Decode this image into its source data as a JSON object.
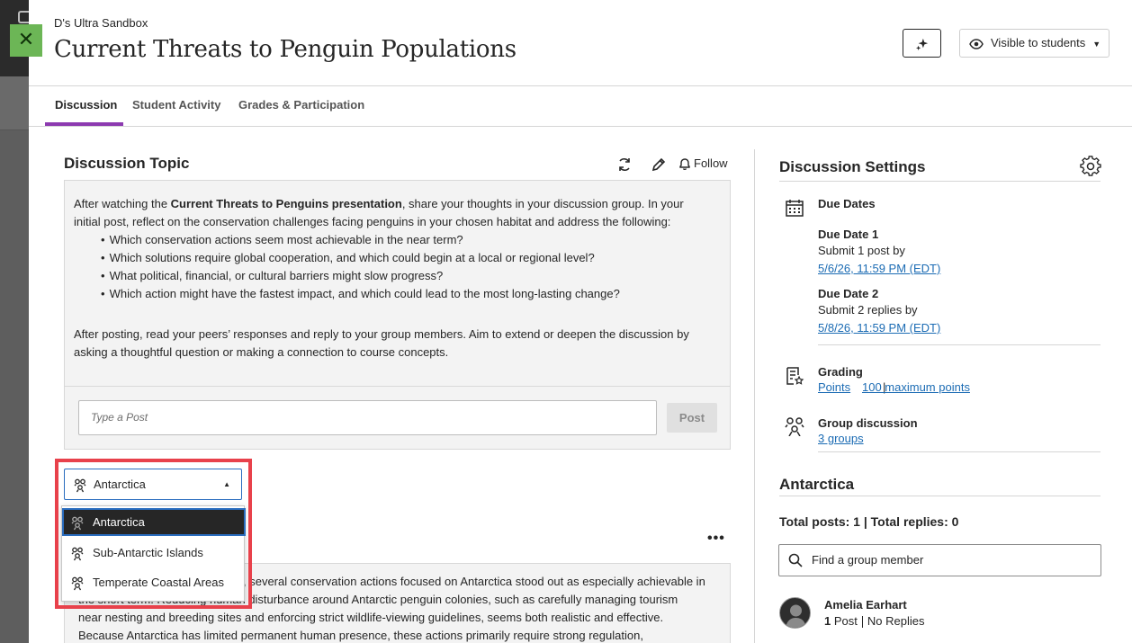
{
  "header": {
    "course_name": "D's Ultra Sandbox",
    "title": "Current Threats to Penguin Populations",
    "visibility_label": "Visible to students",
    "close_icon": "close-icon",
    "ai_icon": "sparkle-icon"
  },
  "tabs": [
    {
      "label": "Discussion",
      "active": true
    },
    {
      "label": "Student Activity",
      "active": false
    },
    {
      "label": "Grades & Participation",
      "active": false
    }
  ],
  "topic": {
    "heading": "Discussion Topic",
    "follow_label": "Follow",
    "intro_pre": "After watching the ",
    "intro_bold": "Current Threats to Penguins presentation",
    "intro_post": ", share your thoughts in your discussion group. In your initial post, reflect on the conservation challenges facing penguins in your chosen habitat and address the following:",
    "bullets": [
      "Which conservation actions seem most achievable in the near term?",
      "Which solutions require global cooperation, and which could begin at a local or regional level?",
      "What political, financial, or cultural barriers might slow progress?",
      "Which action might have the fastest impact, and which could lead to the most long-lasting change?"
    ],
    "closing": "After posting, read your peers’ responses and reply to your group members. Aim to extend or deepen the discussion by asking a thoughtful question or making a connection to course concepts.",
    "post_placeholder": "Type a Post",
    "post_button": "Post"
  },
  "group_select": {
    "selected": "Antarctica",
    "options": [
      "Antarctica",
      "Sub-Antarctic Islands",
      "Temperate Coastal Areas"
    ]
  },
  "post_preview": {
    "more_label": "•••",
    "lines": [
      ", several conservation actions focused on Antarctica stood out as especially achievable in",
      "the short term. Reducing human disturbance around Antarctic penguin colonies, such as carefully managing tourism",
      "near nesting and breeding sites and enforcing strict wildlife-viewing guidelines, seems both realistic and effective.",
      "Because Antarctica has limited permanent human presence, these actions primarily require strong regulation,"
    ]
  },
  "settings": {
    "heading": "Discussion Settings",
    "due_dates_label": "Due Dates",
    "due_date_1_label": "Due Date 1",
    "due_date_1_text": "Submit 1 post by",
    "due_date_1_date": "5/6/26, 11:59 PM (EDT)",
    "due_date_2_label": "Due Date 2",
    "due_date_2_text": "Submit 2 replies by",
    "due_date_2_date": "5/8/26, 11:59 PM (EDT)",
    "grading_label": "Grading",
    "grading_type": "Points",
    "grading_separator": "|",
    "grading_max": "100 maximum points",
    "group_discussion_label": "Group discussion",
    "groups_link": "3 groups"
  },
  "group_panel": {
    "heading": "Antarctica",
    "totals": "Total posts: 1 | Total replies: 0",
    "find_placeholder": "Find a group member",
    "member_name": "Amelia Earhart",
    "member_posts_count": "1",
    "member_posts_label": "Post",
    "member_replies": "No Replies"
  },
  "colors": {
    "accent_purple": "#8c3ab0",
    "link_blue": "#1c6cb4",
    "highlight_red": "#e8414b",
    "close_green": "#6cb656"
  }
}
